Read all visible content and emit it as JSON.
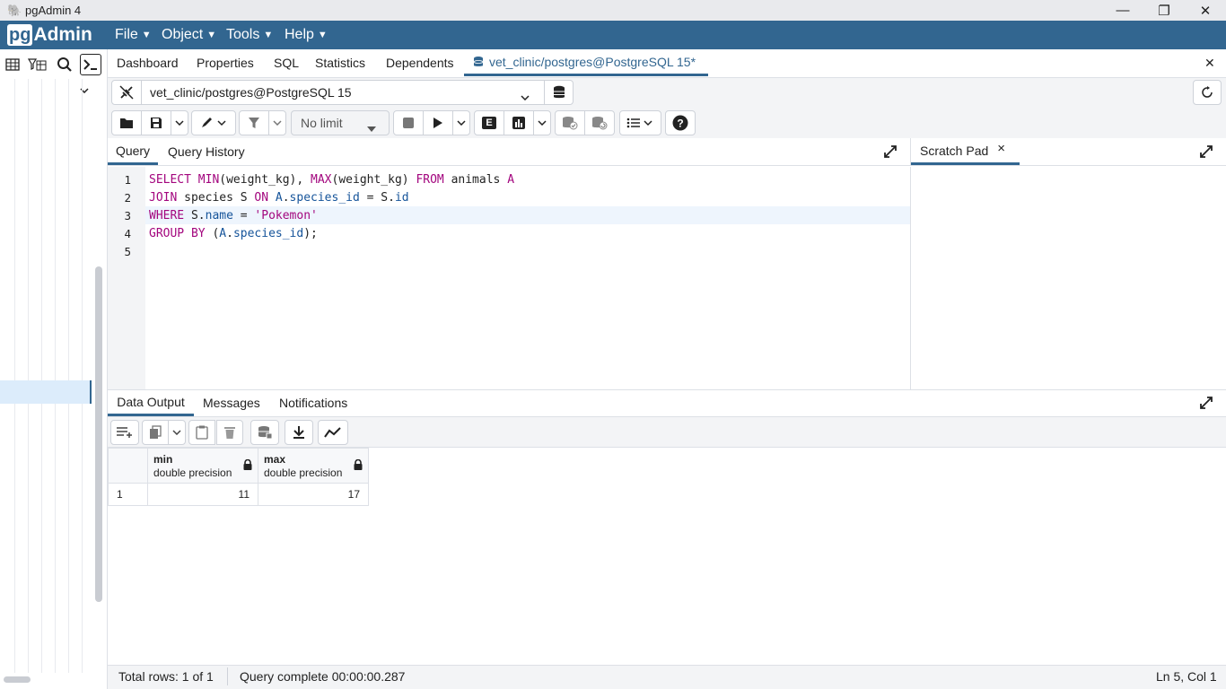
{
  "window": {
    "title": "pgAdmin 4",
    "minimize": "—",
    "restore": "❐",
    "close": "✕"
  },
  "menubar": {
    "logo_pg": "pg",
    "logo_admin": "Admin",
    "items": [
      {
        "label": "File"
      },
      {
        "label": "Object"
      },
      {
        "label": "Tools"
      },
      {
        "label": "Help"
      }
    ]
  },
  "tabs": {
    "items": [
      {
        "label": "Dashboard"
      },
      {
        "label": "Properties"
      },
      {
        "label": "SQL"
      },
      {
        "label": "Statistics"
      },
      {
        "label": "Dependents"
      }
    ],
    "active": {
      "label": "vet_clinic/postgres@PostgreSQL 15*"
    },
    "close": "✕"
  },
  "connection": {
    "value": "vet_clinic/postgres@PostgreSQL 15"
  },
  "toolbar": {
    "limit": "No limit",
    "explain": "E"
  },
  "editor_tabs": {
    "query": "Query",
    "history": "Query History"
  },
  "editor": {
    "line_numbers": [
      "1",
      "2",
      "3",
      "4",
      "5"
    ],
    "highlighted_line": 3
  },
  "scratch": {
    "label": "Scratch Pad",
    "close": "×"
  },
  "results": {
    "tabs": [
      {
        "label": "Data Output",
        "active": true
      },
      {
        "label": "Messages"
      },
      {
        "label": "Notifications"
      }
    ],
    "columns": [
      {
        "name": "min",
        "type": "double precision"
      },
      {
        "name": "max",
        "type": "double precision"
      }
    ],
    "rows": [
      {
        "num": "1",
        "values": [
          "11",
          "17"
        ]
      }
    ]
  },
  "status": {
    "total_rows": "Total rows: 1 of 1",
    "query_complete": "Query complete 00:00:00.287",
    "cursor": "Ln 5, Col 1"
  },
  "colors": {
    "brand": "#326690",
    "keyword": "#a3067e",
    "identifier": "#16549a"
  }
}
